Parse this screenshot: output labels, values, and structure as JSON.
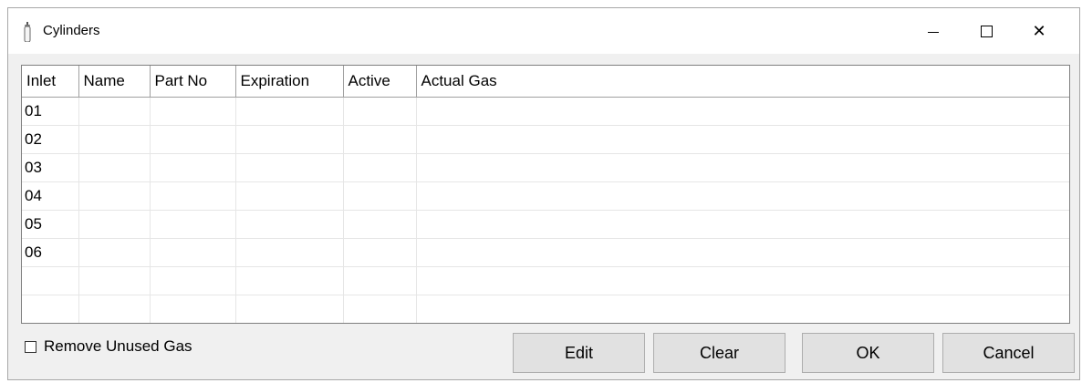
{
  "window": {
    "title": "Cylinders",
    "icon": "gas-cylinder-icon",
    "controls": {
      "minimize": "minimize-icon",
      "maximize": "maximize-icon",
      "close": "close-icon",
      "close_glyph": "✕"
    }
  },
  "grid": {
    "columns": [
      "Inlet",
      "Name",
      "Part No",
      "Expiration",
      "Active",
      "Actual Gas"
    ],
    "rows": [
      [
        "01",
        "",
        "",
        "",
        "",
        ""
      ],
      [
        "02",
        "",
        "",
        "",
        "",
        ""
      ],
      [
        "03",
        "",
        "",
        "",
        "",
        ""
      ],
      [
        "04",
        "",
        "",
        "",
        "",
        ""
      ],
      [
        "05",
        "",
        "",
        "",
        "",
        ""
      ],
      [
        "06",
        "",
        "",
        "",
        "",
        ""
      ],
      [
        "",
        "",
        "",
        "",
        "",
        ""
      ],
      [
        "",
        "",
        "",
        "",
        "",
        ""
      ]
    ]
  },
  "options": {
    "remove_unused_gas_label": "Remove Unused Gas",
    "remove_unused_gas_checked": false
  },
  "buttons": {
    "edit": "Edit",
    "clear": "Clear",
    "ok": "OK",
    "cancel": "Cancel"
  }
}
